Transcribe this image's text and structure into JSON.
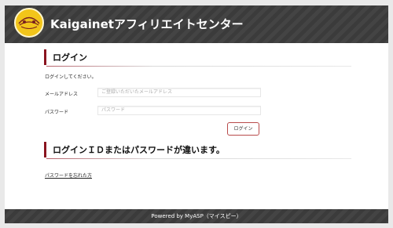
{
  "header": {
    "title": "Kaigainetアフィリエイトセンター",
    "logo_icon": "globe-logo-icon"
  },
  "login": {
    "heading": "ログイン",
    "instruction": "ログインしてください。",
    "email_label": "メールアドレス",
    "email_placeholder": "ご登録いただいたメールアドレス",
    "password_label": "パスワード",
    "password_placeholder": "パスワード",
    "button_label": "ログイン"
  },
  "error": {
    "message": "ログインＩＤまたはパスワードが違います。"
  },
  "forgot_password_link": "パスワードを忘れた方",
  "footer": {
    "text": "Powered by MyASP（マイスピー）"
  },
  "colors": {
    "accent": "#8a1420",
    "header_bg": "#3b3b3b",
    "logo": "#f2c51a",
    "page_bg": "#e9e9e9"
  }
}
